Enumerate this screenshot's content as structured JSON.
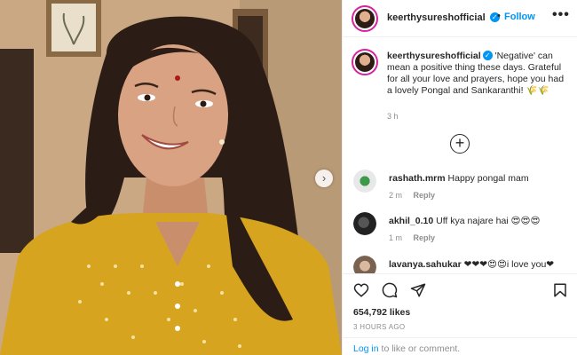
{
  "post": {
    "username": "keerthysureshofficial",
    "separator": "•",
    "follow_label": "Follow",
    "more_label": "•••",
    "caption_text": "'Negative' can mean a positive thing these days. Grateful for all your love and prayers, hope you had a lovely Pongal and Sankaranthi! 🌾🌾",
    "caption_time": "3 h",
    "load_more_label": "+",
    "next_label": "›"
  },
  "comments": [
    {
      "username": "rashath.mrm",
      "text": "Happy pongal mam",
      "age": "2 m",
      "reply": "Reply"
    },
    {
      "username": "akhil_0.10",
      "text": "Uff kya najare hai 😍😍😍",
      "age": "1 m",
      "reply": "Reply"
    },
    {
      "username": "lavanya.sahukar",
      "text": "❤❤❤😍😍i love you❤",
      "age": "",
      "reply": ""
    }
  ],
  "footer": {
    "likes": "654,792 likes",
    "time": "3 HOURS AGO",
    "login_link": "Log in",
    "login_rest": " to like or comment."
  },
  "icons": [
    "verified-icon",
    "heart-icon",
    "comment-icon",
    "share-icon",
    "bookmark-icon",
    "plus-circle-icon",
    "more-icon",
    "chevron-right-icon"
  ],
  "colors": {
    "accent": "#0095f6",
    "muted": "#8e8e8e",
    "text": "#262626",
    "story_ring": "#d6249f"
  }
}
